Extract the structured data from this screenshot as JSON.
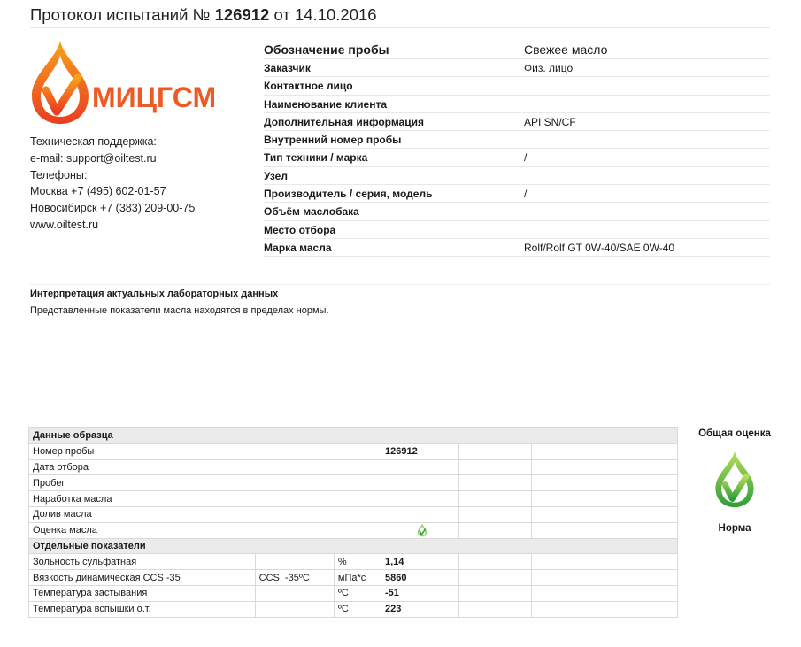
{
  "header": {
    "title_prefix": "Протокол испытаний №",
    "number": "126912",
    "date_prefix": "от",
    "date": "14.10.2016"
  },
  "logo": {
    "text": "МИЦГСМ",
    "color": "#ee5a24"
  },
  "contacts": {
    "support_label": "Техническая поддержка:",
    "email": "e-mail: support@oiltest.ru",
    "phones_label": "Телефоны:",
    "moscow": "Москва +7 (495) 602-01-57",
    "novosibirsk": "Новосибирск +7 (383) 209-00-75",
    "website": "www.oiltest.ru"
  },
  "sample_info": {
    "header_label": "Обозначение пробы",
    "header_value": "Свежее масло",
    "rows": [
      {
        "label": "Заказчик",
        "value": "Физ. лицо"
      },
      {
        "label": "Контактное лицо",
        "value": ""
      },
      {
        "label": "Наименование клиента",
        "value": ""
      },
      {
        "label": "Дополнительная информация",
        "value": "API SN/CF"
      },
      {
        "label": "Внутренний номер пробы",
        "value": ""
      },
      {
        "label": "Тип техники / марка",
        "value": "/"
      },
      {
        "label": "Узел",
        "value": ""
      },
      {
        "label": "Производитель / серия, модель",
        "value": "/"
      },
      {
        "label": "Объём маслобака",
        "value": ""
      },
      {
        "label": "Место отбора",
        "value": ""
      },
      {
        "label": "Марка масла",
        "value": "Rolf/Rolf GT 0W-40/SAE 0W-40"
      }
    ]
  },
  "interpretation": {
    "title": "Интерпретация актуальных лабораторных данных",
    "text": "Представленные показатели масла находятся в пределах нормы."
  },
  "sample_data": {
    "section_label": "Данные образца",
    "rows": [
      {
        "label": "Номер пробы",
        "value": "126912"
      },
      {
        "label": "Дата отбора",
        "value": ""
      },
      {
        "label": "Пробег",
        "value": ""
      },
      {
        "label": "Наработка масла",
        "value": ""
      },
      {
        "label": "Долив масла",
        "value": ""
      },
      {
        "label": "Оценка масла",
        "value": ""
      }
    ]
  },
  "indicators": {
    "section_label": "Отдельные показатели",
    "rows": [
      {
        "label": "Зольность сульфатная",
        "method": "",
        "unit": "%",
        "value": "1,14"
      },
      {
        "label": "Вязкость динамическая CCS -35",
        "method": "CCS, -35ºC",
        "unit": "мПа*с",
        "value": "5860"
      },
      {
        "label": "Температура застывания",
        "method": "",
        "unit": "ºС",
        "value": "-51"
      },
      {
        "label": "Температура вспышки о.т.",
        "method": "",
        "unit": "ºС",
        "value": "223"
      }
    ]
  },
  "overall": {
    "label": "Общая оценка",
    "result": "Норма",
    "icon": "green-drop-check-icon",
    "color": "#2e9e3a"
  }
}
